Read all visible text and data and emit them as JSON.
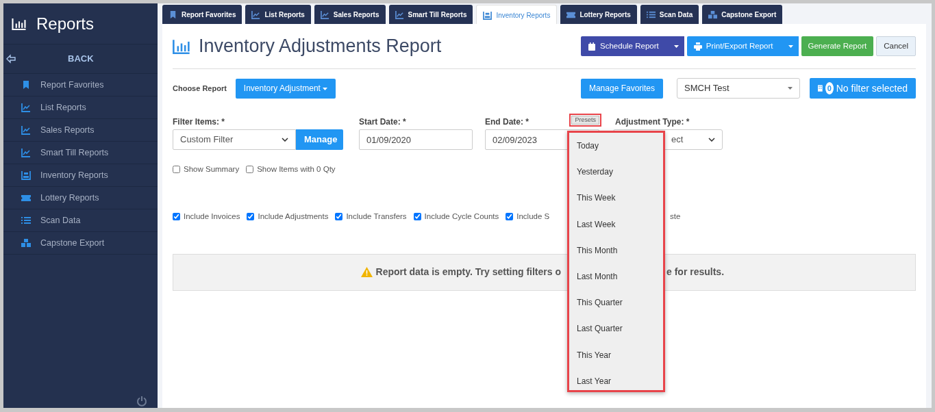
{
  "sidebar": {
    "title": "Reports",
    "back": "BACK",
    "items": [
      {
        "label": "Report Favorites"
      },
      {
        "label": "List Reports"
      },
      {
        "label": "Sales Reports"
      },
      {
        "label": "Smart Till Reports"
      },
      {
        "label": "Inventory Reports"
      },
      {
        "label": "Lottery Reports"
      },
      {
        "label": "Scan Data"
      },
      {
        "label": "Capstone Export"
      }
    ]
  },
  "tabs": [
    {
      "label": "Report Favorites",
      "selected": false
    },
    {
      "label": "List Reports",
      "selected": false
    },
    {
      "label": "Sales Reports",
      "selected": false
    },
    {
      "label": "Smart Till Reports",
      "selected": false
    },
    {
      "label": "Inventory Reports",
      "selected": true
    },
    {
      "label": "Lottery Reports",
      "selected": false
    },
    {
      "label": "Scan Data",
      "selected": false
    },
    {
      "label": "Capstone Export",
      "selected": false
    }
  ],
  "page_title": "Inventory Adjustments Report",
  "actions": {
    "schedule": "Schedule Report",
    "print": "Print/Export Report",
    "generate": "Generate Report",
    "cancel": "Cancel"
  },
  "choose_report": {
    "label": "Choose Report",
    "value": "Inventory Adjustment"
  },
  "manage_favorites": "Manage Favorites",
  "store_select": "SMCH Test",
  "filter_button": {
    "count": "0",
    "label": "No filter selected"
  },
  "filters": {
    "filter_items": {
      "label": "Filter Items: *",
      "value": "Custom Filter",
      "button": "Manage"
    },
    "start_date": {
      "label": "Start Date: *",
      "value": "01/09/2020"
    },
    "end_date": {
      "label": "End Date: *",
      "value": "02/09/2023"
    },
    "presets": "Presets",
    "adjustment_type": {
      "label": "Adjustment Type: *",
      "value": "ect"
    }
  },
  "options": [
    {
      "label": "Show Summary",
      "checked": false
    },
    {
      "label": "Show Items with 0 Qty",
      "checked": false
    }
  ],
  "includes": [
    {
      "kind": "checkbox",
      "label": "Include Invoices",
      "checked": true
    },
    {
      "kind": "checkbox",
      "label": "Include Adjustments",
      "checked": true
    },
    {
      "kind": "checkbox",
      "label": "Include Transfers",
      "checked": true
    },
    {
      "kind": "checkbox",
      "label": "Include Cycle Counts",
      "checked": true
    },
    {
      "kind": "checkbox",
      "label": "Include S",
      "checked": true
    },
    {
      "kind": "fragment",
      "label": "ste"
    }
  ],
  "message": {
    "before": "Report data is empty. Try setting filters o",
    "after": "e for results."
  },
  "preset_menu": [
    "Today",
    "Yesterday",
    "This Week",
    "Last Week",
    "This Month",
    "Last Month",
    "This Quarter",
    "Last Quarter",
    "This Year",
    "Last Year"
  ]
}
